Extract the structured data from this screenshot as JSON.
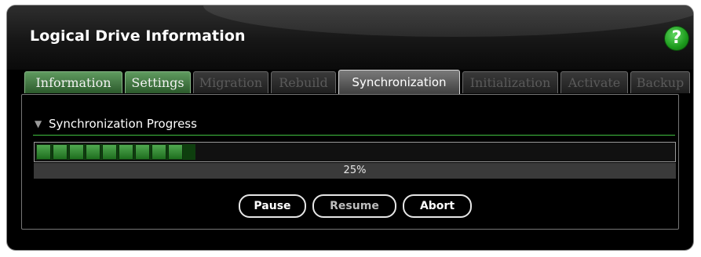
{
  "panel": {
    "title": "Logical Drive Information",
    "help_label": "?"
  },
  "tabs": [
    {
      "label": "Information",
      "state": "enabled"
    },
    {
      "label": "Settings",
      "state": "enabled"
    },
    {
      "label": "Migration",
      "state": "disabled"
    },
    {
      "label": "Rebuild",
      "state": "disabled"
    },
    {
      "label": "Synchronization",
      "state": "active"
    },
    {
      "label": "Initialization",
      "state": "disabled"
    },
    {
      "label": "Activate",
      "state": "disabled"
    },
    {
      "label": "Backup",
      "state": "disabled"
    }
  ],
  "section": {
    "title": "Synchronization Progress"
  },
  "progress": {
    "value": 0.25,
    "label": "25%"
  },
  "buttons": {
    "pause": "Pause",
    "resume": "Resume",
    "abort": "Abort"
  },
  "colors": {
    "accent_green": "#3fbf3f",
    "help_green": "#1c9a1c"
  },
  "icons": {
    "help": "help-icon",
    "section_toggle": "chevron-double-down-icon"
  }
}
